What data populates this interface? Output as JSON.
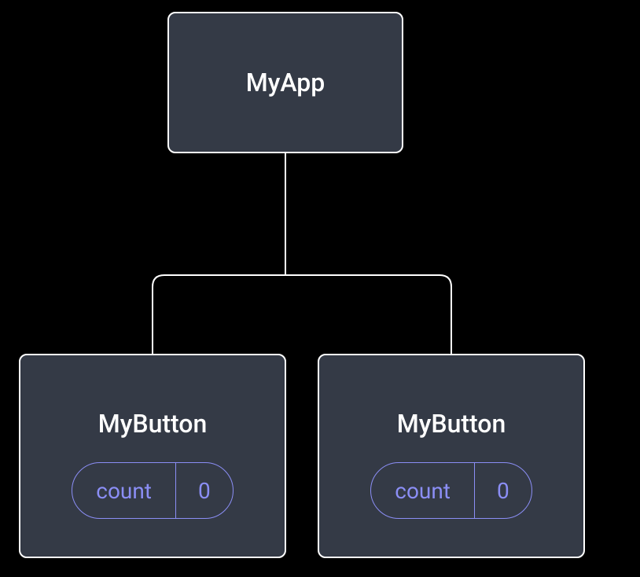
{
  "tree": {
    "root": {
      "label": "MyApp"
    },
    "children": [
      {
        "label": "MyButton",
        "state": {
          "name": "count",
          "value": "0"
        }
      },
      {
        "label": "MyButton",
        "state": {
          "name": "count",
          "value": "0"
        }
      }
    ]
  }
}
